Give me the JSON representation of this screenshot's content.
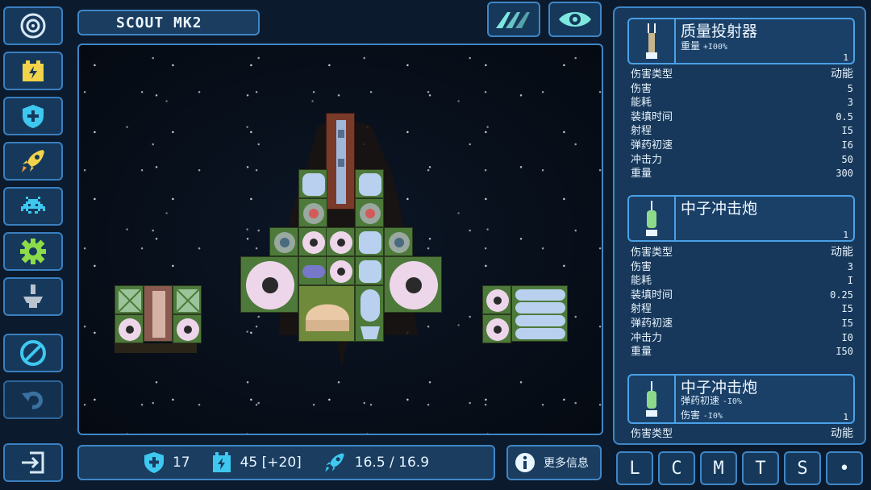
{
  "ship": {
    "name": "SCOUT MK2"
  },
  "toolbar": {
    "items": [
      {
        "name": "target-icon"
      },
      {
        "name": "battery-icon"
      },
      {
        "name": "shield-icon"
      },
      {
        "name": "rocket-icon"
      },
      {
        "name": "alien-icon"
      },
      {
        "name": "gear-icon"
      },
      {
        "name": "ship-silhouette-icon"
      },
      {
        "name": "prohibit-icon"
      },
      {
        "name": "undo-icon"
      },
      {
        "name": "exit-icon"
      }
    ]
  },
  "header_buttons": [
    {
      "name": "wings-icon"
    },
    {
      "name": "eye-icon"
    }
  ],
  "stats": {
    "shield": "17",
    "energy": "45 [+20]",
    "speed": "16.5 / 16.9"
  },
  "more_info": "更多信息",
  "modules": [
    {
      "name": "质量投射器",
      "sub_label": "重量",
      "sub_value": "+I00%",
      "qty": "1",
      "props": [
        {
          "k": "伤害类型",
          "v": "动能"
        },
        {
          "k": "伤害",
          "v": "5"
        },
        {
          "k": "能耗",
          "v": "3"
        },
        {
          "k": "装填时间",
          "v": "0.5"
        },
        {
          "k": "射程",
          "v": "I5"
        },
        {
          "k": "弹药初速",
          "v": "I6"
        },
        {
          "k": "冲击力",
          "v": "50"
        },
        {
          "k": "重量",
          "v": "300"
        }
      ]
    },
    {
      "name": "中子冲击炮",
      "qty": "1",
      "props": [
        {
          "k": "伤害类型",
          "v": "动能"
        },
        {
          "k": "伤害",
          "v": "3"
        },
        {
          "k": "能耗",
          "v": "I"
        },
        {
          "k": "装填时间",
          "v": "0.25"
        },
        {
          "k": "射程",
          "v": "I5"
        },
        {
          "k": "弹药初速",
          "v": "I5"
        },
        {
          "k": "冲击力",
          "v": "I0"
        },
        {
          "k": "重量",
          "v": "I50"
        }
      ]
    },
    {
      "name": "中子冲击炮",
      "sub1_label": "弹药初速",
      "sub1_value": "-I0%",
      "sub2_label": "伤害",
      "sub2_value": "-I0%",
      "qty": "1",
      "props": [
        {
          "k": "伤害类型",
          "v": "动能"
        }
      ]
    }
  ],
  "filter_tabs": [
    "L",
    "C",
    "M",
    "T",
    "S",
    "•"
  ],
  "colors": {
    "accent": "#3f86c6",
    "panel": "#16395b",
    "highlight": "#7ee8e0",
    "warn": "#f2d34a"
  }
}
